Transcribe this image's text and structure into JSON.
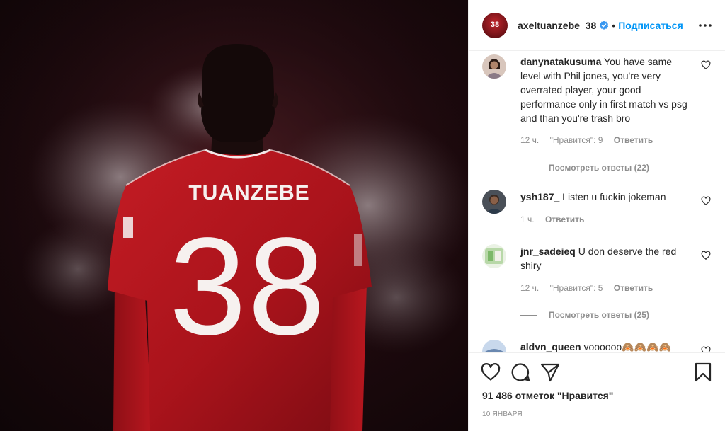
{
  "post": {
    "jersey_name": "TUANZEBE",
    "jersey_number": "38"
  },
  "header": {
    "username": "axeltuanzebe_38",
    "avatar_text": "38",
    "verified_icon": "verified-badge-icon",
    "separator": "•",
    "follow_label": "Подписаться",
    "more_icon": "more-options-icon"
  },
  "comments": [
    {
      "username": "danynatakusuma",
      "text": "You have same level with Phil jones, you're very overrated player, your good performance only in first match vs psg and than you're trash bro",
      "time": "12 ч.",
      "likes": "\"Нравится\": 9",
      "reply_label": "Ответить",
      "view_replies": "Посмотреть ответы (22)"
    },
    {
      "username": "ysh187_",
      "text": "Listen u fuckin jokeman",
      "time": "1 ч.",
      "reply_label": "Ответить"
    },
    {
      "username": "jnr_sadeieq",
      "text": "U don deserve the red shiry",
      "time": "12 ч.",
      "likes": "\"Нравится\": 5",
      "reply_label": "Ответить",
      "view_replies": "Посмотреть ответы (25)"
    },
    {
      "username": "aldvn_queen",
      "text": "voooooo🙈🙈🙈🙈"
    }
  ],
  "footer": {
    "like_icon": "heart-icon",
    "comment_icon": "comment-icon",
    "share_icon": "share-icon",
    "save_icon": "bookmark-icon",
    "likes_text": "91 486 отметок \"Нравится\"",
    "date": "10 ЯНВАРЯ"
  },
  "colors": {
    "accent": "#0095f6",
    "jersey": "#b3141c",
    "muted": "#8e8e8e"
  }
}
